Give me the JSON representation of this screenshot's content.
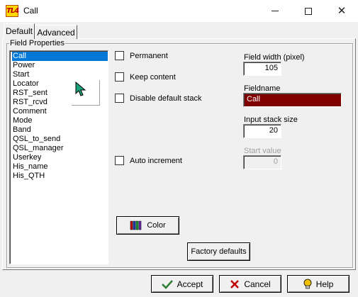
{
  "window": {
    "title": "Call",
    "app_icon_text": "TL4"
  },
  "tabs": [
    {
      "label": "Default"
    },
    {
      "label": "Advanced"
    }
  ],
  "group": {
    "label": "Field Properties"
  },
  "fields_list": {
    "items": [
      "Call",
      "Power",
      "Start",
      "Locator",
      "RST_sent",
      "RST_rcvd",
      "Comment",
      "Mode",
      "Band",
      "QSL_to_send",
      "QSL_manager",
      "Userkey",
      "His_name",
      "His_QTH"
    ],
    "selected": "Call"
  },
  "options": {
    "permanent": {
      "label": "Permanent",
      "checked": false
    },
    "keep_content": {
      "label": "Keep content",
      "checked": false
    },
    "disable_default_stack": {
      "label": "Disable default stack",
      "checked": false
    },
    "auto_increment": {
      "label": "Auto increment",
      "checked": false
    }
  },
  "field_width": {
    "label": "Field width (pixel)",
    "value": "105"
  },
  "fieldname": {
    "label": "Fieldname",
    "value": "Call"
  },
  "input_stack_size": {
    "label": "Input stack size",
    "value": "20"
  },
  "start_value": {
    "label": "Start value",
    "value": "0",
    "disabled": true
  },
  "buttons": {
    "color": "Color",
    "factory_defaults": "Factory defaults",
    "accept": "Accept",
    "cancel": "Cancel",
    "help": "Help"
  },
  "colors": {
    "selection": "#0078d7",
    "fieldname_bg": "#800000",
    "accept_check": "#2e7d32",
    "cancel_x": "#c00000",
    "help_bulb": "#f2c200"
  },
  "icons": {
    "app": "app-logo-icon",
    "cursor": "mouse-pointer-icon",
    "color": "color-bars-icon",
    "accept": "checkmark-icon",
    "cancel": "x-icon",
    "help": "lightbulb-icon"
  }
}
